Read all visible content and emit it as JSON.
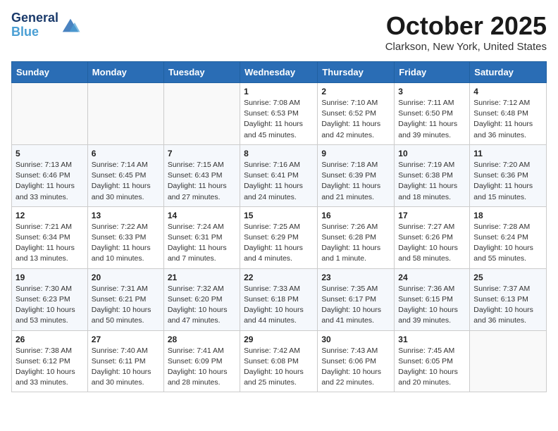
{
  "header": {
    "logo_line1": "General",
    "logo_line2": "Blue",
    "month": "October 2025",
    "location": "Clarkson, New York, United States"
  },
  "days_of_week": [
    "Sunday",
    "Monday",
    "Tuesday",
    "Wednesday",
    "Thursday",
    "Friday",
    "Saturday"
  ],
  "weeks": [
    [
      {
        "day": "",
        "info": ""
      },
      {
        "day": "",
        "info": ""
      },
      {
        "day": "",
        "info": ""
      },
      {
        "day": "1",
        "info": "Sunrise: 7:08 AM\nSunset: 6:53 PM\nDaylight: 11 hours and 45 minutes."
      },
      {
        "day": "2",
        "info": "Sunrise: 7:10 AM\nSunset: 6:52 PM\nDaylight: 11 hours and 42 minutes."
      },
      {
        "day": "3",
        "info": "Sunrise: 7:11 AM\nSunset: 6:50 PM\nDaylight: 11 hours and 39 minutes."
      },
      {
        "day": "4",
        "info": "Sunrise: 7:12 AM\nSunset: 6:48 PM\nDaylight: 11 hours and 36 minutes."
      }
    ],
    [
      {
        "day": "5",
        "info": "Sunrise: 7:13 AM\nSunset: 6:46 PM\nDaylight: 11 hours and 33 minutes."
      },
      {
        "day": "6",
        "info": "Sunrise: 7:14 AM\nSunset: 6:45 PM\nDaylight: 11 hours and 30 minutes."
      },
      {
        "day": "7",
        "info": "Sunrise: 7:15 AM\nSunset: 6:43 PM\nDaylight: 11 hours and 27 minutes."
      },
      {
        "day": "8",
        "info": "Sunrise: 7:16 AM\nSunset: 6:41 PM\nDaylight: 11 hours and 24 minutes."
      },
      {
        "day": "9",
        "info": "Sunrise: 7:18 AM\nSunset: 6:39 PM\nDaylight: 11 hours and 21 minutes."
      },
      {
        "day": "10",
        "info": "Sunrise: 7:19 AM\nSunset: 6:38 PM\nDaylight: 11 hours and 18 minutes."
      },
      {
        "day": "11",
        "info": "Sunrise: 7:20 AM\nSunset: 6:36 PM\nDaylight: 11 hours and 15 minutes."
      }
    ],
    [
      {
        "day": "12",
        "info": "Sunrise: 7:21 AM\nSunset: 6:34 PM\nDaylight: 11 hours and 13 minutes."
      },
      {
        "day": "13",
        "info": "Sunrise: 7:22 AM\nSunset: 6:33 PM\nDaylight: 11 hours and 10 minutes."
      },
      {
        "day": "14",
        "info": "Sunrise: 7:24 AM\nSunset: 6:31 PM\nDaylight: 11 hours and 7 minutes."
      },
      {
        "day": "15",
        "info": "Sunrise: 7:25 AM\nSunset: 6:29 PM\nDaylight: 11 hours and 4 minutes."
      },
      {
        "day": "16",
        "info": "Sunrise: 7:26 AM\nSunset: 6:28 PM\nDaylight: 11 hours and 1 minute."
      },
      {
        "day": "17",
        "info": "Sunrise: 7:27 AM\nSunset: 6:26 PM\nDaylight: 10 hours and 58 minutes."
      },
      {
        "day": "18",
        "info": "Sunrise: 7:28 AM\nSunset: 6:24 PM\nDaylight: 10 hours and 55 minutes."
      }
    ],
    [
      {
        "day": "19",
        "info": "Sunrise: 7:30 AM\nSunset: 6:23 PM\nDaylight: 10 hours and 53 minutes."
      },
      {
        "day": "20",
        "info": "Sunrise: 7:31 AM\nSunset: 6:21 PM\nDaylight: 10 hours and 50 minutes."
      },
      {
        "day": "21",
        "info": "Sunrise: 7:32 AM\nSunset: 6:20 PM\nDaylight: 10 hours and 47 minutes."
      },
      {
        "day": "22",
        "info": "Sunrise: 7:33 AM\nSunset: 6:18 PM\nDaylight: 10 hours and 44 minutes."
      },
      {
        "day": "23",
        "info": "Sunrise: 7:35 AM\nSunset: 6:17 PM\nDaylight: 10 hours and 41 minutes."
      },
      {
        "day": "24",
        "info": "Sunrise: 7:36 AM\nSunset: 6:15 PM\nDaylight: 10 hours and 39 minutes."
      },
      {
        "day": "25",
        "info": "Sunrise: 7:37 AM\nSunset: 6:13 PM\nDaylight: 10 hours and 36 minutes."
      }
    ],
    [
      {
        "day": "26",
        "info": "Sunrise: 7:38 AM\nSunset: 6:12 PM\nDaylight: 10 hours and 33 minutes."
      },
      {
        "day": "27",
        "info": "Sunrise: 7:40 AM\nSunset: 6:11 PM\nDaylight: 10 hours and 30 minutes."
      },
      {
        "day": "28",
        "info": "Sunrise: 7:41 AM\nSunset: 6:09 PM\nDaylight: 10 hours and 28 minutes."
      },
      {
        "day": "29",
        "info": "Sunrise: 7:42 AM\nSunset: 6:08 PM\nDaylight: 10 hours and 25 minutes."
      },
      {
        "day": "30",
        "info": "Sunrise: 7:43 AM\nSunset: 6:06 PM\nDaylight: 10 hours and 22 minutes."
      },
      {
        "day": "31",
        "info": "Sunrise: 7:45 AM\nSunset: 6:05 PM\nDaylight: 10 hours and 20 minutes."
      },
      {
        "day": "",
        "info": ""
      }
    ]
  ]
}
